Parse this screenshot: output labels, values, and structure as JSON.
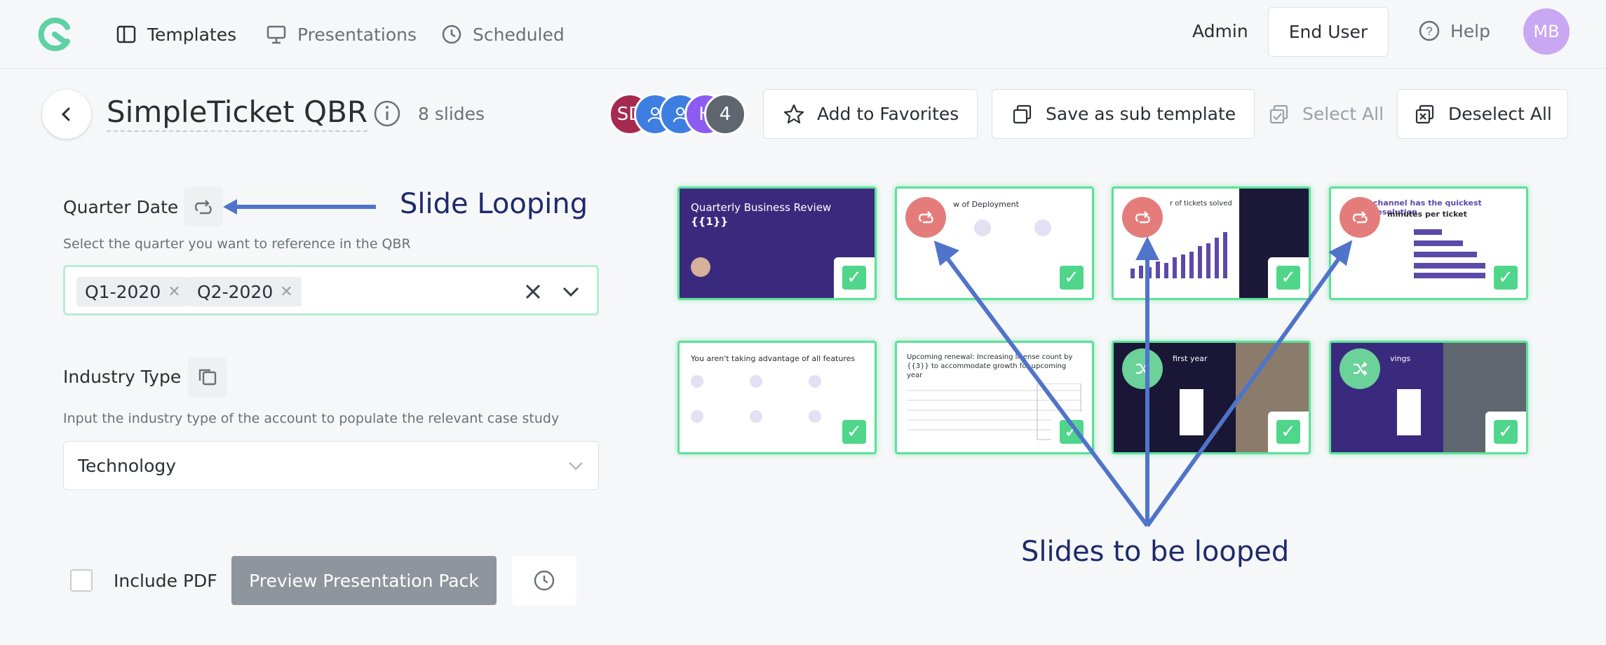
{
  "nav": {
    "items": [
      {
        "label": "Templates",
        "icon": "template-icon",
        "active": true
      },
      {
        "label": "Presentations",
        "icon": "presentation-icon",
        "active": false
      },
      {
        "label": "Scheduled",
        "icon": "clock-icon",
        "active": false
      }
    ],
    "admin": "Admin",
    "end_user": "End User",
    "help": "Help",
    "avatar": "MB"
  },
  "header": {
    "title": "SimpleTicket QBR",
    "slide_count": "8 slides",
    "collaborators": [
      {
        "initials": "SD",
        "color": "#a52a4f"
      },
      {
        "initials": "",
        "color": "#3e7ee0"
      },
      {
        "initials": "",
        "color": "#3e7ee0"
      },
      {
        "initials": "H",
        "color": "#8e5bf2"
      },
      {
        "initials": "4",
        "color": "#5f6670"
      }
    ],
    "add_favorites": "Add to Favorites",
    "save_sub_template": "Save as sub template",
    "select_all": "Select All",
    "deselect_all": "Deselect All"
  },
  "form": {
    "quarter_label": "Quarter Date",
    "quarter_hint": "Select the quarter you want to reference in the QBR",
    "quarter_values": [
      "Q1-2020",
      "Q2-2020"
    ],
    "industry_label": "Industry Type",
    "industry_hint": "Input the industry type of the account to populate the relevant case study",
    "industry_value": "Technology",
    "include_pdf": "Include PDF",
    "preview_button": "Preview Presentation Pack"
  },
  "annotations": {
    "slide_looping": "Slide Looping",
    "slides_to_loop": "Slides to be looped"
  },
  "slides": [
    {
      "title": "Quarterly Business Review",
      "subtitle": "{{1}}",
      "theme": "dark"
    },
    {
      "title": "w of Deployment",
      "theme": "light",
      "loop": true
    },
    {
      "title": "r of tickets solved",
      "theme": "light",
      "loop": true
    },
    {
      "title": "channel has the quickest resolution",
      "subtitle": "minutes per ticket",
      "theme": "light",
      "loop": true
    },
    {
      "title": "You aren't taking advantage of all features",
      "theme": "light"
    },
    {
      "title": "Upcoming renewal: Increasing license count by {{3}} to accommodate growth for upcoming year",
      "theme": "light"
    },
    {
      "title": "first year",
      "theme": "darkphoto",
      "green": true
    },
    {
      "title": "vings",
      "theme": "darkphoto",
      "green": true
    }
  ],
  "colors": {
    "accent_green": "#4fd68a",
    "loop_red": "#e57c7c",
    "slide_purple": "#3a2a7d",
    "annotation_blue": "#1e2a6b",
    "arrow_blue": "#4f74c9"
  }
}
